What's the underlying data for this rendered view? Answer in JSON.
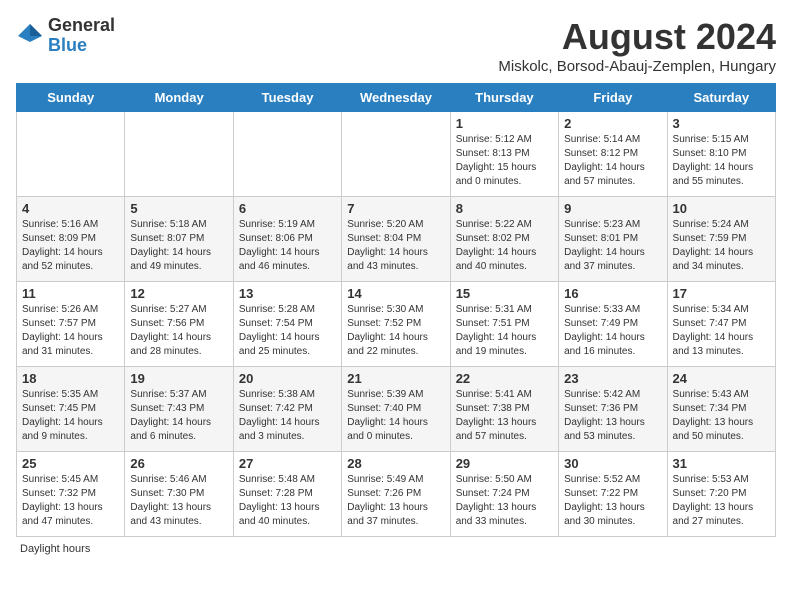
{
  "logo": {
    "general": "General",
    "blue": "Blue"
  },
  "title": "August 2024",
  "subtitle": "Miskolc, Borsod-Abauj-Zemplen, Hungary",
  "days_of_week": [
    "Sunday",
    "Monday",
    "Tuesday",
    "Wednesday",
    "Thursday",
    "Friday",
    "Saturday"
  ],
  "weeks": [
    [
      {
        "day": "",
        "info": ""
      },
      {
        "day": "",
        "info": ""
      },
      {
        "day": "",
        "info": ""
      },
      {
        "day": "",
        "info": ""
      },
      {
        "day": "1",
        "info": "Sunrise: 5:12 AM\nSunset: 8:13 PM\nDaylight: 15 hours and 0 minutes."
      },
      {
        "day": "2",
        "info": "Sunrise: 5:14 AM\nSunset: 8:12 PM\nDaylight: 14 hours and 57 minutes."
      },
      {
        "day": "3",
        "info": "Sunrise: 5:15 AM\nSunset: 8:10 PM\nDaylight: 14 hours and 55 minutes."
      }
    ],
    [
      {
        "day": "4",
        "info": "Sunrise: 5:16 AM\nSunset: 8:09 PM\nDaylight: 14 hours and 52 minutes."
      },
      {
        "day": "5",
        "info": "Sunrise: 5:18 AM\nSunset: 8:07 PM\nDaylight: 14 hours and 49 minutes."
      },
      {
        "day": "6",
        "info": "Sunrise: 5:19 AM\nSunset: 8:06 PM\nDaylight: 14 hours and 46 minutes."
      },
      {
        "day": "7",
        "info": "Sunrise: 5:20 AM\nSunset: 8:04 PM\nDaylight: 14 hours and 43 minutes."
      },
      {
        "day": "8",
        "info": "Sunrise: 5:22 AM\nSunset: 8:02 PM\nDaylight: 14 hours and 40 minutes."
      },
      {
        "day": "9",
        "info": "Sunrise: 5:23 AM\nSunset: 8:01 PM\nDaylight: 14 hours and 37 minutes."
      },
      {
        "day": "10",
        "info": "Sunrise: 5:24 AM\nSunset: 7:59 PM\nDaylight: 14 hours and 34 minutes."
      }
    ],
    [
      {
        "day": "11",
        "info": "Sunrise: 5:26 AM\nSunset: 7:57 PM\nDaylight: 14 hours and 31 minutes."
      },
      {
        "day": "12",
        "info": "Sunrise: 5:27 AM\nSunset: 7:56 PM\nDaylight: 14 hours and 28 minutes."
      },
      {
        "day": "13",
        "info": "Sunrise: 5:28 AM\nSunset: 7:54 PM\nDaylight: 14 hours and 25 minutes."
      },
      {
        "day": "14",
        "info": "Sunrise: 5:30 AM\nSunset: 7:52 PM\nDaylight: 14 hours and 22 minutes."
      },
      {
        "day": "15",
        "info": "Sunrise: 5:31 AM\nSunset: 7:51 PM\nDaylight: 14 hours and 19 minutes."
      },
      {
        "day": "16",
        "info": "Sunrise: 5:33 AM\nSunset: 7:49 PM\nDaylight: 14 hours and 16 minutes."
      },
      {
        "day": "17",
        "info": "Sunrise: 5:34 AM\nSunset: 7:47 PM\nDaylight: 14 hours and 13 minutes."
      }
    ],
    [
      {
        "day": "18",
        "info": "Sunrise: 5:35 AM\nSunset: 7:45 PM\nDaylight: 14 hours and 9 minutes."
      },
      {
        "day": "19",
        "info": "Sunrise: 5:37 AM\nSunset: 7:43 PM\nDaylight: 14 hours and 6 minutes."
      },
      {
        "day": "20",
        "info": "Sunrise: 5:38 AM\nSunset: 7:42 PM\nDaylight: 14 hours and 3 minutes."
      },
      {
        "day": "21",
        "info": "Sunrise: 5:39 AM\nSunset: 7:40 PM\nDaylight: 14 hours and 0 minutes."
      },
      {
        "day": "22",
        "info": "Sunrise: 5:41 AM\nSunset: 7:38 PM\nDaylight: 13 hours and 57 minutes."
      },
      {
        "day": "23",
        "info": "Sunrise: 5:42 AM\nSunset: 7:36 PM\nDaylight: 13 hours and 53 minutes."
      },
      {
        "day": "24",
        "info": "Sunrise: 5:43 AM\nSunset: 7:34 PM\nDaylight: 13 hours and 50 minutes."
      }
    ],
    [
      {
        "day": "25",
        "info": "Sunrise: 5:45 AM\nSunset: 7:32 PM\nDaylight: 13 hours and 47 minutes."
      },
      {
        "day": "26",
        "info": "Sunrise: 5:46 AM\nSunset: 7:30 PM\nDaylight: 13 hours and 43 minutes."
      },
      {
        "day": "27",
        "info": "Sunrise: 5:48 AM\nSunset: 7:28 PM\nDaylight: 13 hours and 40 minutes."
      },
      {
        "day": "28",
        "info": "Sunrise: 5:49 AM\nSunset: 7:26 PM\nDaylight: 13 hours and 37 minutes."
      },
      {
        "day": "29",
        "info": "Sunrise: 5:50 AM\nSunset: 7:24 PM\nDaylight: 13 hours and 33 minutes."
      },
      {
        "day": "30",
        "info": "Sunrise: 5:52 AM\nSunset: 7:22 PM\nDaylight: 13 hours and 30 minutes."
      },
      {
        "day": "31",
        "info": "Sunrise: 5:53 AM\nSunset: 7:20 PM\nDaylight: 13 hours and 27 minutes."
      }
    ]
  ],
  "footer": "Daylight hours"
}
